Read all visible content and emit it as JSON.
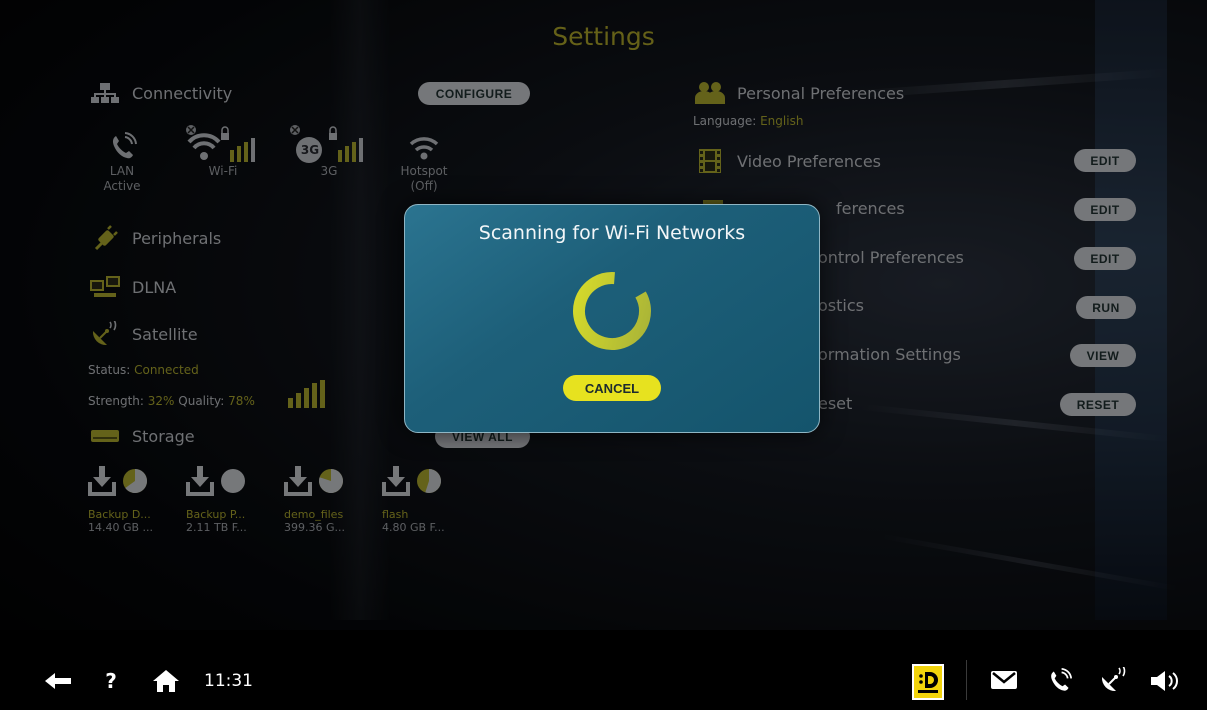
{
  "page": {
    "title": "Settings"
  },
  "connectivity": {
    "title": "Connectivity",
    "configure_label": "CONFIGURE",
    "items": [
      {
        "label": "LAN",
        "sub": "Active"
      },
      {
        "label": "Wi-Fi",
        "sub": ""
      },
      {
        "label": "3G",
        "sub": ""
      },
      {
        "label": "Hotspot",
        "sub": "(Off)"
      }
    ],
    "badge_3g": "3G"
  },
  "peripherals": {
    "title": "Peripherals"
  },
  "dlna": {
    "title": "DLNA"
  },
  "satellite": {
    "title": "Satellite",
    "status_label": "Status:",
    "status_value": "Connected",
    "strength_label": "Strength:",
    "strength_value": "32%",
    "quality_label": "Quality:",
    "quality_value": "78%"
  },
  "storage": {
    "title": "Storage",
    "view_all_label": "VIEW ALL",
    "items": [
      {
        "name": "Backup D...",
        "size": "14.40 GB ...",
        "fill": 0.65
      },
      {
        "name": "Backup P...",
        "size": "2.11 TB F...",
        "fill": 1.0
      },
      {
        "name": "demo_files",
        "size": "399.36 G...",
        "fill": 0.8
      },
      {
        "name": "flash",
        "size": "4.80 GB F...",
        "fill": 0.55
      }
    ]
  },
  "right_panel": {
    "personal": {
      "title": "Personal Preferences",
      "language_label": "Language:",
      "language_value": "English"
    },
    "rows": [
      {
        "title": "Video Preferences",
        "button": "EDIT"
      },
      {
        "title": "ferences",
        "button": "EDIT"
      },
      {
        "title": "ontrol Preferences",
        "button": "EDIT"
      },
      {
        "title": "ostics",
        "button": "RUN"
      },
      {
        "title": "ormation Settings",
        "button": "VIEW"
      },
      {
        "title": "eset",
        "button": "RESET"
      }
    ]
  },
  "modal": {
    "title": "Scanning for Wi-Fi Networks",
    "cancel_label": "CANCEL"
  },
  "bottom_bar": {
    "time": "11:31"
  },
  "colors": {
    "accent": "#e7e21f",
    "modal_bg": "#1d5f79",
    "title_yellow": "#b9b12c"
  },
  "icons": [
    "back-arrow-icon",
    "help-icon",
    "home-icon",
    "dolby-d-logo",
    "mail-icon",
    "phone-icon",
    "satellite-icon",
    "volume-icon"
  ]
}
